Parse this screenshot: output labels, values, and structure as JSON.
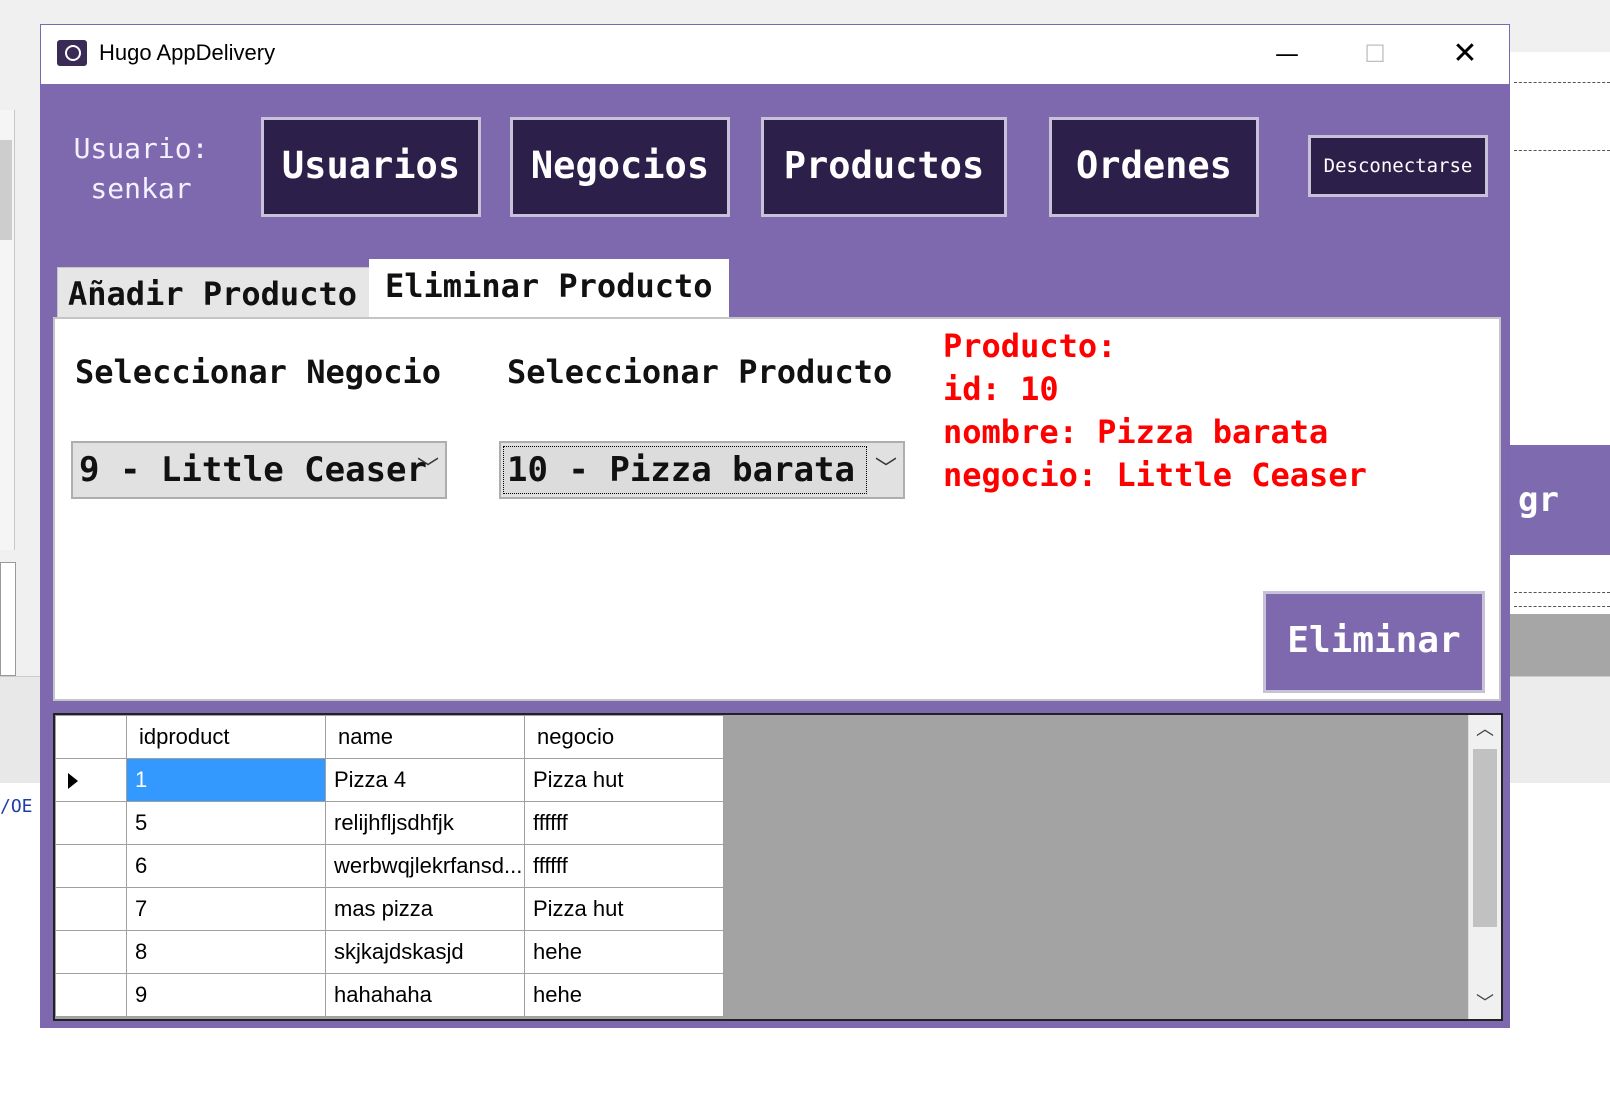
{
  "window": {
    "title": "Hugo AppDelivery"
  },
  "header": {
    "user_label": "Usuario:",
    "user_name": "senkar",
    "nav": [
      "Usuarios",
      "Negocios",
      "Productos",
      "Ordenes"
    ],
    "logout": "Desconectarse"
  },
  "tabs": {
    "add": "Añadir Producto",
    "delete": "Eliminar Producto",
    "active": "delete"
  },
  "form": {
    "negocio_label": "Seleccionar Negocio",
    "producto_label": "Seleccionar Producto",
    "negocio_value": "9 - Little Ceaser",
    "producto_value": "10 - Pizza barata"
  },
  "info": {
    "line1": "Producto:",
    "line2": "id: 10",
    "line3": "nombre: Pizza barata",
    "line4": "negocio: Little Ceaser"
  },
  "delete_button": "Eliminar",
  "grid": {
    "columns": [
      "idproduct",
      "name",
      "negocio"
    ],
    "rows": [
      [
        "1",
        "Pizza 4",
        "Pizza hut"
      ],
      [
        "5",
        "relijhfljsdhfjk",
        "ffffff"
      ],
      [
        "6",
        "werbwqjlekrfansd...",
        "ffffff"
      ],
      [
        "7",
        "mas pizza",
        "Pizza hut"
      ],
      [
        "8",
        "skjkajdskasjd",
        "hehe"
      ],
      [
        "9",
        "hahahaha",
        "hehe"
      ]
    ]
  },
  "background": {
    "left_text": "/OE",
    "right_button_fragment": "gr"
  },
  "colors": {
    "accent": "#7e69ae",
    "nav_dark": "#2c1f4a",
    "info_red": "#ff0000",
    "selection": "#3399ff"
  }
}
